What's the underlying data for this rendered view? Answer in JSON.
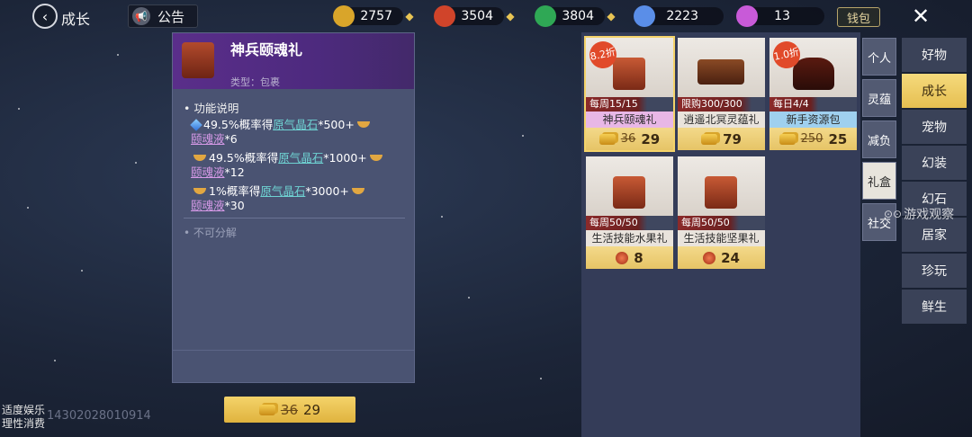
{
  "header": {
    "title": "成长",
    "notice_label": "公告",
    "currencies": [
      {
        "value": "2757",
        "color": "#d9a52a"
      },
      {
        "value": "3504",
        "color": "#d0442a"
      },
      {
        "value": "3804",
        "color": "#2fa855"
      },
      {
        "value": "2223",
        "color": "#5a8ee8"
      },
      {
        "value": "13",
        "color": "#c85ad8"
      }
    ],
    "wallet_label": "钱包",
    "close_symbol": "✕"
  },
  "detail": {
    "name": "神兵颐魂礼",
    "type": "类型：包裹",
    "section_title": "功能说明",
    "rewards": [
      {
        "prefix": "49.5%概率得",
        "item": "原气晶石",
        "qty": "*500+",
        "item2": "颐魂液",
        "qty2": "*6"
      },
      {
        "prefix": "49.5%概率得",
        "item": "原气晶石",
        "qty": "*1000+",
        "item2": "颐魂液",
        "qty2": "*12"
      },
      {
        "prefix": "1%概率得",
        "item": "原气晶石",
        "qty": "*3000+",
        "item2": "颐魂液",
        "qty2": "*30"
      }
    ],
    "no_decompose": "不可分解"
  },
  "buy": {
    "old_price": "36",
    "price": "29"
  },
  "footnote": {
    "line1": "适度娱乐",
    "line2": "理性消费",
    "serial": "14302028010914"
  },
  "shop": {
    "items": [
      {
        "badge": "8.2折",
        "limit": "每周15/15",
        "name": "神兵颐魂礼",
        "name_bg": "#e8b7e6",
        "old_price": "36",
        "price": "29",
        "currency": "coin",
        "selected": true
      },
      {
        "badge": "",
        "limit": "限购300/300",
        "name": "逍遥北冥灵蕴礼",
        "name_bg": "#e9e3dc",
        "old_price": "",
        "price": "79",
        "currency": "coin",
        "selected": false
      },
      {
        "badge": "1.0折",
        "limit": "每日4/4",
        "name": "新手资源包",
        "name_bg": "#9fd0ef",
        "old_price": "250",
        "price": "25",
        "currency": "coin",
        "selected": false
      },
      {
        "badge": "",
        "limit": "每周50/50",
        "name": "生活技能水果礼",
        "name_bg": "#e9e3dc",
        "old_price": "",
        "price": "8",
        "currency": "ore",
        "selected": false
      },
      {
        "badge": "",
        "limit": "每周50/50",
        "name": "生活技能坚果礼",
        "name_bg": "#e9e3dc",
        "old_price": "",
        "price": "24",
        "currency": "ore",
        "selected": false
      }
    ]
  },
  "subtabs": [
    "个人",
    "灵蕴",
    "减负",
    "礼盒",
    "社交"
  ],
  "maintabs": [
    "好物",
    "成长",
    "宠物",
    "幻装",
    "幻石",
    "居家",
    "珍玩",
    "鲜生"
  ],
  "watermark": "游戏观察"
}
